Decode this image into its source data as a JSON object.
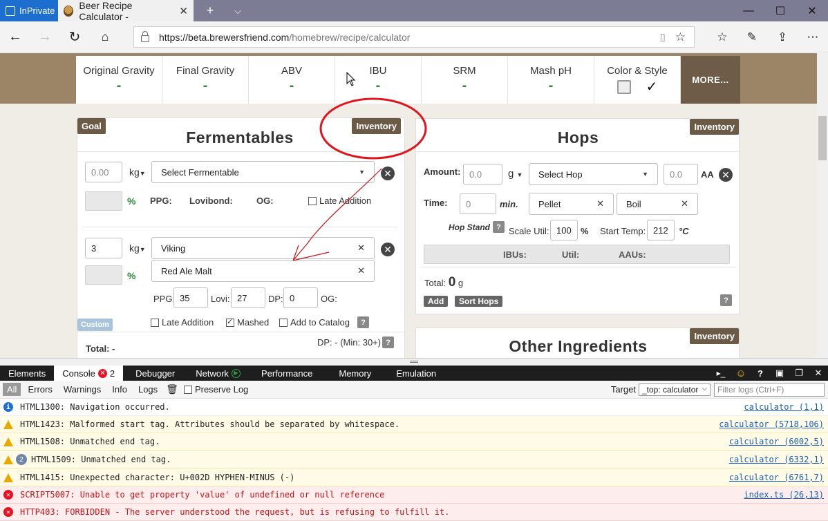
{
  "browser": {
    "inprivate_label": "InPrivate",
    "tab_title": "Beer Recipe Calculator -",
    "url_host": "https://beta.brewersfriend.com",
    "url_path": "/homebrew/recipe/calculator"
  },
  "stats": {
    "items": [
      {
        "label": "Original Gravity",
        "value": "-"
      },
      {
        "label": "Final Gravity",
        "value": "-"
      },
      {
        "label": "ABV",
        "value": "-"
      },
      {
        "label": "IBU",
        "value": "-"
      },
      {
        "label": "SRM",
        "value": "-"
      },
      {
        "label": "Mash pH",
        "value": "-"
      },
      {
        "label": "Color & Style",
        "value": "✓"
      }
    ],
    "more_label": "MORE..."
  },
  "fermentables": {
    "title": "Fermentables",
    "goal_label": "Goal",
    "inventory_label": "Inventory",
    "row1": {
      "amount_placeholder": "0.00",
      "unit": "kg",
      "select_placeholder": "Select Fermentable",
      "pct": "%",
      "ppg_label": "PPG:",
      "lovibond_label": "Lovibond:",
      "og_label": "OG:",
      "late_addition_label": "Late Addition"
    },
    "row2": {
      "amount": "3",
      "unit": "kg",
      "brand": "Viking",
      "grain": "Red Ale Malt",
      "pct": "%",
      "ppg_label": "PPG:",
      "ppg": "35",
      "lovi_label": "Lovi:",
      "lovi": "27",
      "dp_label": "DP:",
      "dp": "0",
      "og_label": "OG:",
      "late_addition_label": "Late Addition",
      "mashed_label": "Mashed",
      "add_catalog_label": "Add to Catalog",
      "custom_label": "Custom"
    },
    "total_label": "Total:",
    "total_value": "-",
    "dp_summary": "DP: - (Min: 30+)"
  },
  "hops": {
    "title": "Hops",
    "inventory_label": "Inventory",
    "amount_label": "Amount:",
    "amount_placeholder": "0.0",
    "unit": "g",
    "select_placeholder": "Select Hop",
    "aa_placeholder": "0.0",
    "aa_label": "AA",
    "time_label": "Time:",
    "time_placeholder": "0",
    "min_label": "min.",
    "form": "Pellet",
    "use": "Boil",
    "hop_stand_label": "Hop Stand",
    "scale_util_label": "Scale Util:",
    "scale_util": "100",
    "scale_util_unit": "%",
    "start_temp_label": "Start Temp:",
    "start_temp": "212",
    "temp_unit": "°C",
    "ibus_label": "IBUs:",
    "util_label": "Util:",
    "aaus_label": "AAUs:",
    "total_label": "Total:",
    "total_value": "0",
    "total_unit": "g",
    "add_label": "Add",
    "sort_label": "Sort Hops"
  },
  "other": {
    "title": "Other Ingredients",
    "inventory_label": "Inventory"
  },
  "devtools": {
    "tabs": [
      "Elements",
      "Console",
      "Debugger",
      "Network",
      "Performance",
      "Memory",
      "Emulation"
    ],
    "console_error_count": "2",
    "filters": [
      "All",
      "Errors",
      "Warnings",
      "Info",
      "Logs"
    ],
    "preserve_log_label": "Preserve Log",
    "target_label": "Target",
    "target_value": "_top: calculator",
    "filter_placeholder": "Filter logs (Ctrl+F)",
    "messages": [
      {
        "level": "info",
        "text": "HTML1300: Navigation occurred.",
        "source": "calculator (1,1)"
      },
      {
        "level": "warn",
        "text": "HTML1423: Malformed start tag. Attributes should be separated by whitespace.",
        "source": "calculator (5718,106)"
      },
      {
        "level": "warn",
        "text": "HTML1508: Unmatched end tag.",
        "source": "calculator (6002,5)"
      },
      {
        "level": "warn",
        "text": "HTML1509: Unmatched end tag.",
        "source": "calculator (6332,1)",
        "count": "2"
      },
      {
        "level": "warn",
        "text": "HTML1415: Unexpected character: U+002D HYPHEN-MINUS (-)",
        "source": "calculator (6761,7)"
      },
      {
        "level": "err",
        "text": "SCRIPT5007: Unable to get property 'value' of undefined or null reference",
        "source": "index.ts (26,13)"
      },
      {
        "level": "err",
        "text": "HTTP403: FORBIDDEN - The server understood the request, but is refusing to fulfill it.",
        "source": ""
      }
    ]
  },
  "colors": {
    "header_band": "#9c8566",
    "button_brown": "#6b5a46",
    "green": "#2e8b3a",
    "annotation_red": "#e0141c"
  }
}
